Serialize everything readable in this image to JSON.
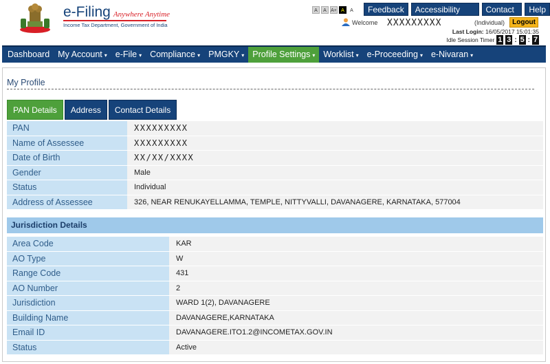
{
  "header": {
    "brand_title": "e-Filing",
    "brand_tagline": "Anywhere Anytime",
    "brand_subtitle": "Income Tax Department, Government of India",
    "font_sizes": [
      "A",
      "A",
      "A+",
      "A",
      "A"
    ],
    "top_links": [
      "Feedback",
      "Accessibility Options",
      "Contact Us",
      "Help"
    ],
    "welcome_label": "Welcome",
    "welcome_name": "XXXXXXXXX",
    "user_type": "(Individual)",
    "logout_label": "Logout",
    "last_login_label": "Last Login:",
    "last_login_value": "16/05/2017 15:01:35",
    "idle_label": "Idle Session Timer",
    "timer_digits": [
      "1",
      "3",
      "5",
      "7"
    ]
  },
  "nav": {
    "items": [
      {
        "label": "Dashboard",
        "caret": false
      },
      {
        "label": "My Account",
        "caret": true
      },
      {
        "label": "e-File",
        "caret": true
      },
      {
        "label": "Compliance",
        "caret": true
      },
      {
        "label": "PMGKY",
        "caret": true
      },
      {
        "label": "Profile Settings",
        "caret": true,
        "active": true
      },
      {
        "label": "Worklist",
        "caret": true
      },
      {
        "label": "e-Proceeding",
        "caret": true
      },
      {
        "label": "e-Nivaran",
        "caret": true
      }
    ],
    "caret_glyph": "▾"
  },
  "page": {
    "title": "My Profile",
    "tabs": [
      "PAN Details",
      "Address",
      "Contact Details"
    ]
  },
  "pan_details": [
    {
      "label": "PAN",
      "value": "XXXXXXXXX",
      "mono": true
    },
    {
      "label": "Name of Assessee",
      "value": "XXXXXXXXX",
      "mono": true
    },
    {
      "label": "Date of Birth",
      "value": "XX/XX/XXXX",
      "mono": true
    },
    {
      "label": "Gender",
      "value": "Male"
    },
    {
      "label": "Status",
      "value": "Individual"
    },
    {
      "label": "Address of Assessee",
      "value": "326, NEAR RENUKAYELLAMMA, TEMPLE, NITTYVALLI, DAVANAGERE, KARNATAKA, 577004"
    }
  ],
  "jurisdiction": {
    "heading": "Jurisdiction Details",
    "rows": [
      {
        "label": "Area Code",
        "value": "KAR"
      },
      {
        "label": "AO Type",
        "value": "W"
      },
      {
        "label": "Range Code",
        "value": "431"
      },
      {
        "label": "AO Number",
        "value": "2"
      },
      {
        "label": "Jurisdiction",
        "value": "WARD 1(2), DAVANAGERE"
      },
      {
        "label": "Building Name",
        "value": "DAVANAGERE,KARNATAKA"
      },
      {
        "label": "Email ID",
        "value": "DAVANAGERE.ITO1.2@INCOMETAX.GOV.IN"
      },
      {
        "label": "Status",
        "value": "Active"
      }
    ]
  },
  "colors": {
    "brand_blue": "#16437a",
    "active_green": "#4ea03b",
    "label_bg": "#c9e2f4",
    "section_bg": "#9fc9ea",
    "logout_yellow": "#f6b51c"
  }
}
